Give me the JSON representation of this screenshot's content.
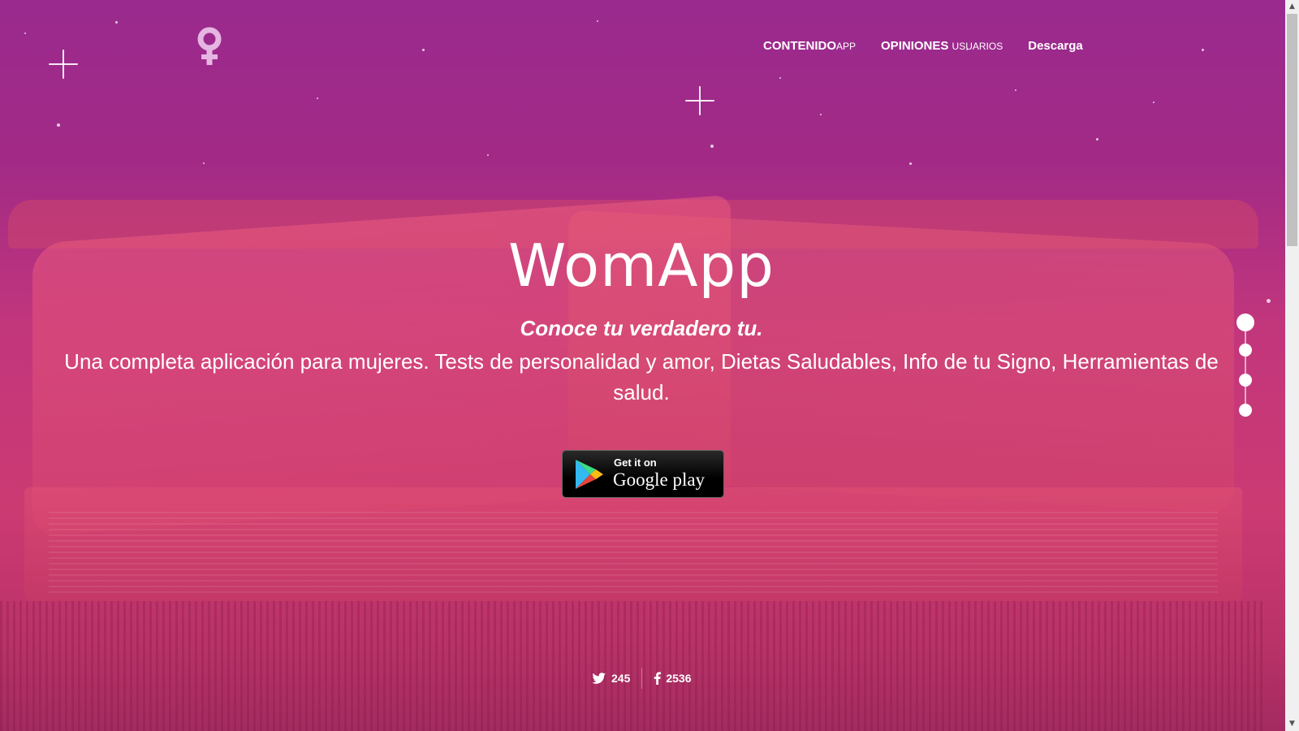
{
  "brand": {
    "logo_icon": "venus-icon"
  },
  "nav": {
    "items": [
      {
        "main": "CONTENIDO",
        "suffix": "APP"
      },
      {
        "main": "OPINIONES",
        "suffix": "USUARIOS"
      },
      {
        "main": "Descarga",
        "suffix": ""
      }
    ]
  },
  "hero": {
    "title": "WomApp",
    "tagline": "Conoce tu verdadero tu.",
    "description": "Una completa aplicación para mujeres. Tests de personalidad y amor, Dietas Saludables, Info de tu Signo, Herramientas de salud."
  },
  "store_badge": {
    "line1": "Get it on",
    "line2": "Google play",
    "icon": "google-play-icon"
  },
  "social": {
    "twitter_count": "245",
    "facebook_count": "2536"
  },
  "section_dots": {
    "count": 4,
    "active_index": 0
  },
  "colors": {
    "background_top": "#9a2a8e",
    "background_mid": "#cc3a72",
    "text": "#ffffff"
  }
}
